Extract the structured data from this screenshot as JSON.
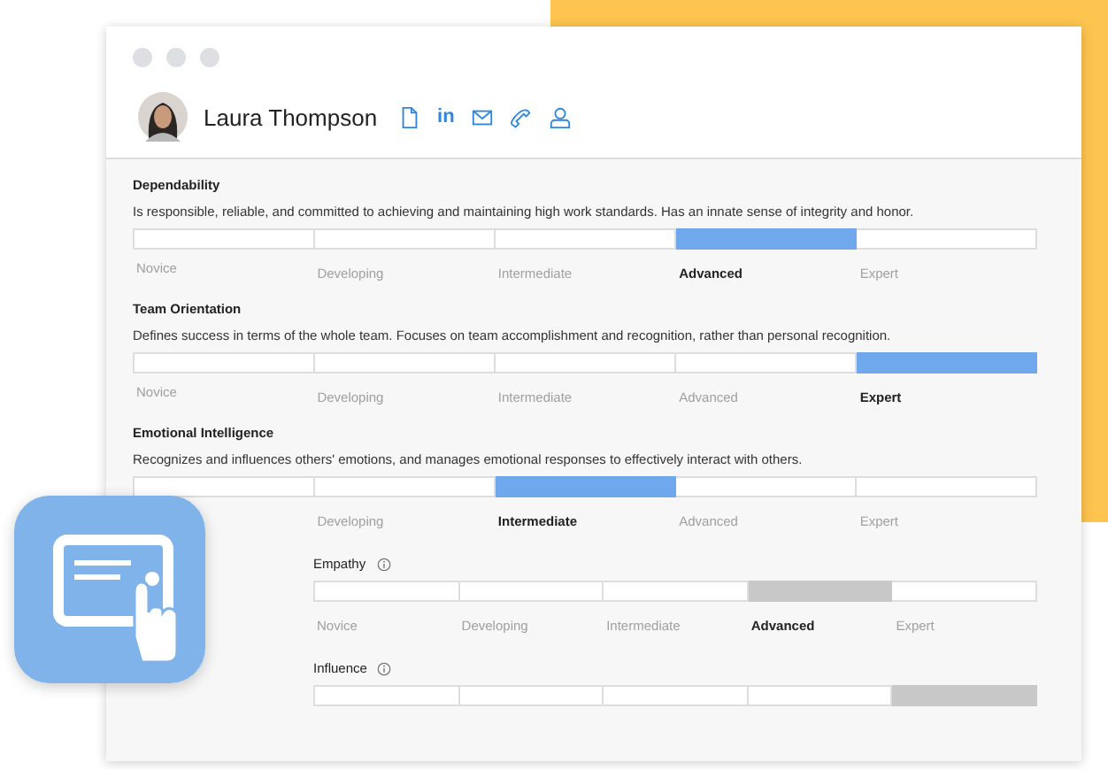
{
  "profile": {
    "name": "Laura Thompson",
    "actions": [
      {
        "kind": "document"
      },
      {
        "kind": "linkedin",
        "text": "in"
      },
      {
        "kind": "mail"
      },
      {
        "kind": "phone"
      },
      {
        "kind": "person"
      }
    ]
  },
  "competencies": [
    {
      "title": "Dependability",
      "description": "Is responsible, reliable, and committed to achieving and maintaining high work standards. Has an innate sense of integrity and honor.",
      "levels": [
        {
          "label": "Novice",
          "selected": false
        },
        {
          "label": "Developing",
          "selected": false
        },
        {
          "label": "Intermediate",
          "selected": false
        },
        {
          "label": "Advanced",
          "selected": true
        },
        {
          "label": "Expert",
          "selected": false
        }
      ]
    },
    {
      "title": "Team Orientation",
      "description": "Defines success in terms of the whole team. Focuses on team accomplishment and recognition, rather than personal recognition.",
      "levels": [
        {
          "label": "Novice",
          "selected": false
        },
        {
          "label": "Developing",
          "selected": false
        },
        {
          "label": "Intermediate",
          "selected": false
        },
        {
          "label": "Advanced",
          "selected": false
        },
        {
          "label": "Expert",
          "selected": true
        }
      ]
    },
    {
      "title": "Emotional Intelligence",
      "description": "Recognizes and influences others' emotions, and manages emotional responses to effectively interact with others.",
      "levels": [
        {
          "selected": false
        },
        {
          "label": "Developing",
          "selected": false
        },
        {
          "label": "Intermediate",
          "selected": true
        },
        {
          "label": "Advanced",
          "selected": false
        },
        {
          "label": "Expert",
          "selected": false
        }
      ],
      "children": [
        {
          "title": "Empathy",
          "levels": [
            {
              "label": "Novice",
              "selected": false
            },
            {
              "label": "Developing",
              "selected": false
            },
            {
              "label": "Intermediate",
              "selected": false
            },
            {
              "label": "Advanced",
              "selected": true
            },
            {
              "label": "Expert",
              "selected": false
            }
          ]
        },
        {
          "title": "Influence",
          "levels": [
            {
              "selected": false
            },
            {
              "selected": false
            },
            {
              "selected": false
            },
            {
              "selected": false
            },
            {
              "selected": true
            }
          ]
        }
      ]
    }
  ]
}
